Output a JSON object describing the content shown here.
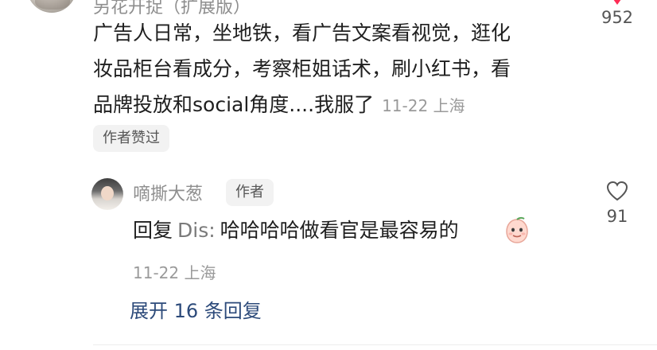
{
  "top_comment": {
    "username": "另花开捉（扩展版）",
    "lines": [
      "广告人日常，坐地铁，看广告文案看视觉，逛化",
      "妆品柜台看成分，考察柜姐话术，刷小红书，看",
      "品牌投放和social角度....我服了"
    ],
    "meta": "11-22 上海",
    "author_liked_tag": "作者赞过",
    "like_count": "952",
    "like_icon": "heart-filled-icon"
  },
  "reply": {
    "username": "嘀撕大葱",
    "author_badge": "作者",
    "prefix": "回复",
    "target": "Dis:",
    "text": "哈哈哈哈做看官是最容易的",
    "emoji": "peach-face-emoji",
    "meta": "11-22 上海",
    "like_count": "91",
    "like_icon": "heart-outline-icon"
  },
  "expand_replies": "展开 16 条回复",
  "colors": {
    "like_red": "#fe2c55",
    "link_blue": "#2c4a7a",
    "meta_gray": "#9a9a9a",
    "tag_bg": "#f2f2f2"
  }
}
